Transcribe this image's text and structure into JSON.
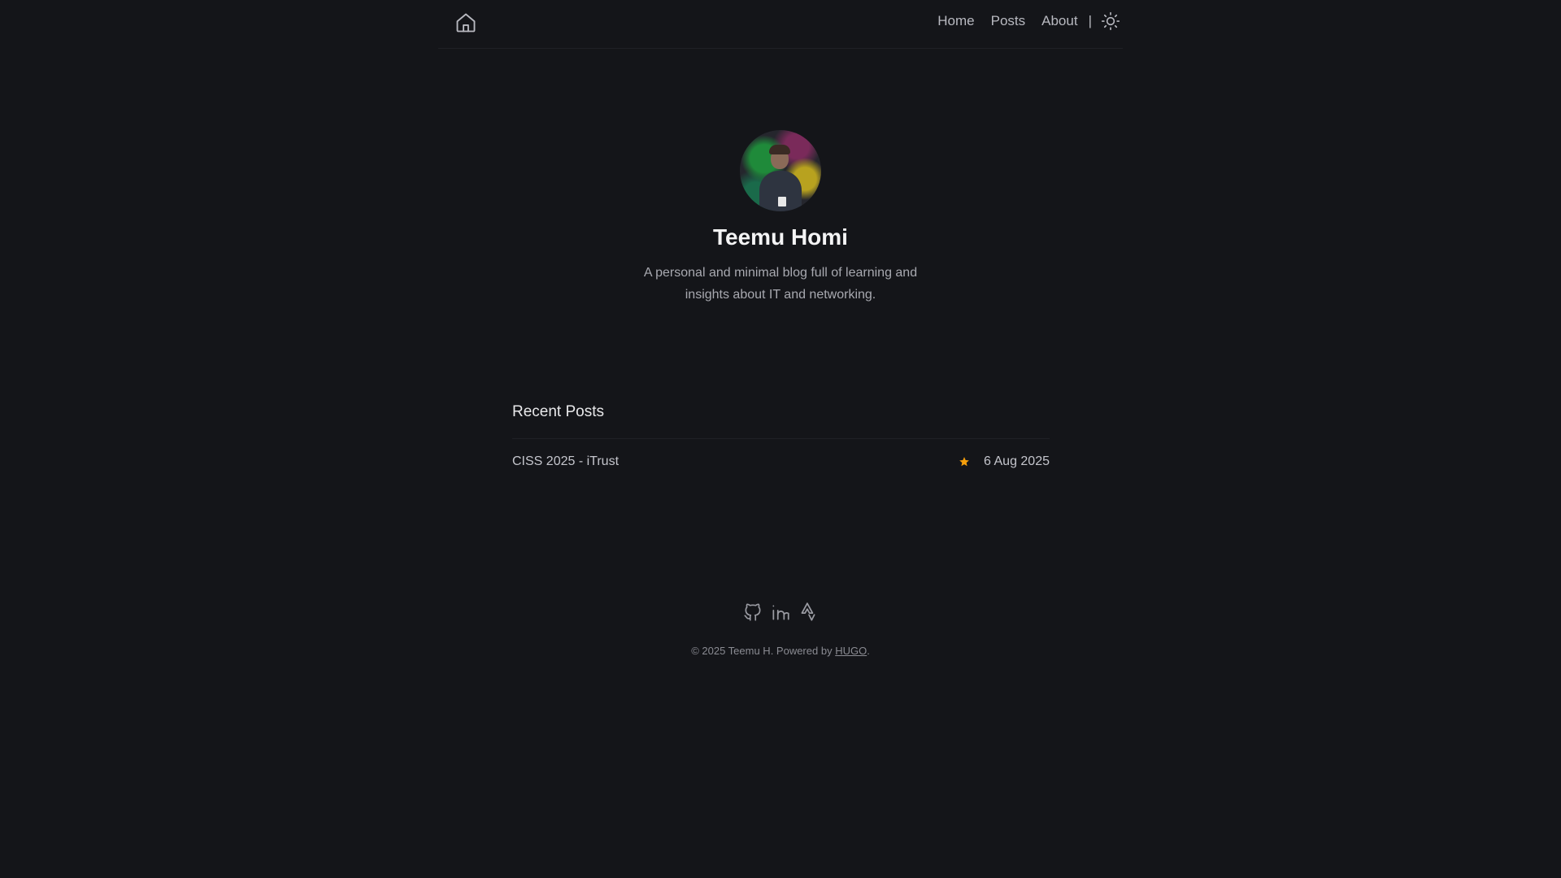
{
  "header": {
    "home_icon": "home-icon",
    "nav": {
      "home": "Home",
      "posts": "Posts",
      "about": "About",
      "separator": "|"
    },
    "theme_icon": "sun-icon"
  },
  "hero": {
    "name": "Teemu Homi",
    "description": "A personal and minimal blog full of learning and insights about IT and networking."
  },
  "recent_posts": {
    "heading": "Recent Posts",
    "items": [
      {
        "title": "CISS 2025 - iTrust",
        "featured": true,
        "date": "6 Aug 2025"
      }
    ]
  },
  "footer": {
    "social_icons": [
      "github-icon",
      "linkedin-icon",
      "strava-icon"
    ],
    "copyright_prefix": "© 2025 Teemu H. Powered by ",
    "powered_by": "HUGO",
    "copyright_suffix": "."
  },
  "colors": {
    "background": "#141519",
    "star": "#f59e0b",
    "text": "#e4e4e7",
    "muted": "#a8a9b0"
  }
}
